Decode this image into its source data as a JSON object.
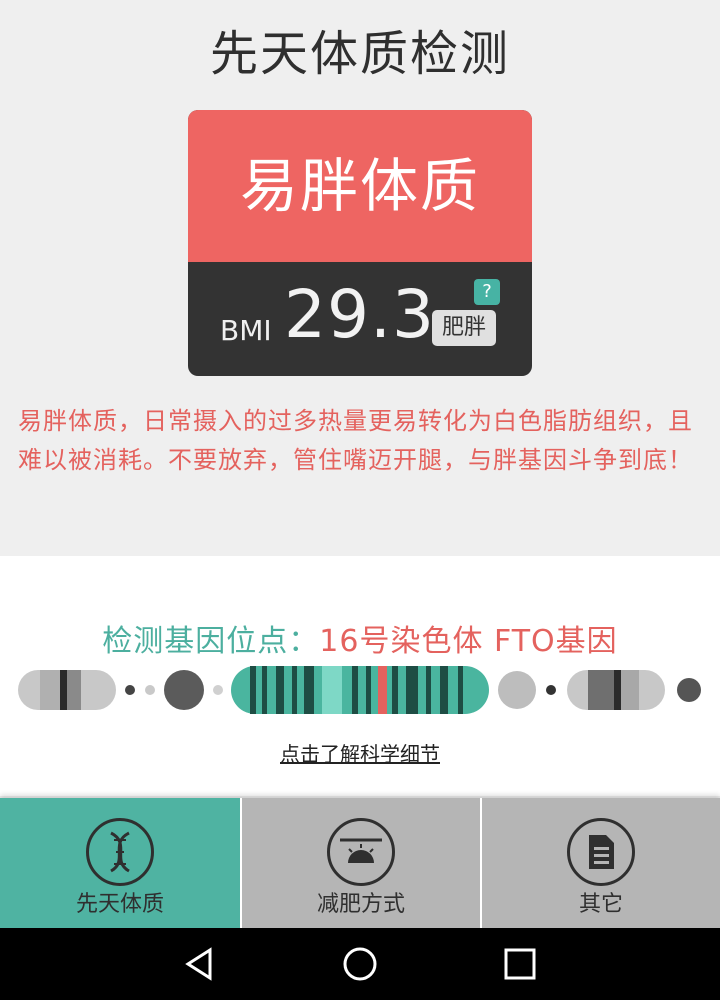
{
  "page": {
    "title": "先天体质检测"
  },
  "result_card": {
    "constitution": "易胖体质",
    "bmi_label": "BMI",
    "bmi_value": "29.3",
    "help_label": "?",
    "bmi_status": "肥胖",
    "colors": {
      "header": "#ee6562",
      "body": "#333333",
      "help": "#47b3a4"
    }
  },
  "description": "易胖体质，日常摄入的过多热量更易转化为白色脂肪组织，且难以被消耗。不要放弃，管住嘴迈开腿，与胖基因斗争到底！",
  "gene_site": {
    "label": "检测基因位点：",
    "value": "16号染色体 FTO基因",
    "link_text": "点击了解科学细节"
  },
  "tabs": [
    {
      "label": "先天体质",
      "icon": "dna-icon",
      "active": true
    },
    {
      "label": "减肥方式",
      "icon": "gauge-icon",
      "active": false
    },
    {
      "label": "其它",
      "icon": "document-icon",
      "active": false
    }
  ],
  "nav": {
    "back": "back-icon",
    "home": "home-icon",
    "recent": "recent-apps-icon"
  },
  "colors": {
    "accent_teal": "#4fb3a2",
    "accent_red": "#e4625e"
  }
}
